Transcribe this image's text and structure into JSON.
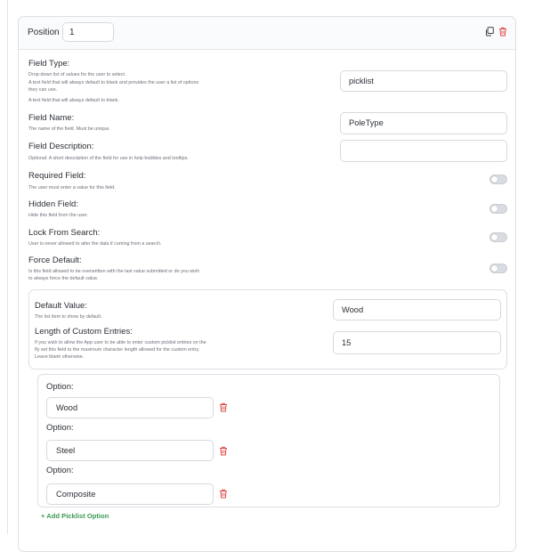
{
  "header": {
    "position_label": "Position",
    "position_value": "1",
    "copy_icon": "copy-icon",
    "delete_icon": "trash-icon"
  },
  "fields": {
    "field_type": {
      "title": "Field Type:",
      "desc1": "Drop-down list of values for the user to select.",
      "desc2": "A text field that will always default to blank and provides the user a list of options",
      "desc3": "they can use.",
      "desc4": "A text field that will always default to blank.",
      "value": "picklist"
    },
    "field_name": {
      "title": "Field Name:",
      "desc": "The name of the field. Must be unique.",
      "value": "PoleType"
    },
    "field_description": {
      "title": "Field Description:",
      "desc": "Optional: A short description of the field for use in help bubbles and tooltips.",
      "value": ""
    },
    "required": {
      "title": "Required Field:",
      "desc": "The user must enter a value for this field.",
      "on": false
    },
    "hidden": {
      "title": "Hidden Field:",
      "desc": "Hide this field from the user.",
      "on": false
    },
    "lock": {
      "title": "Lock From Search:",
      "desc": "User is never allowed to alter the data if coming from a search.",
      "on": false
    },
    "force_default": {
      "title": "Force Default:",
      "desc1": "Is this field allowed to be overwritten with the last value submitted or do you wish",
      "desc2": "to always force the default value.",
      "on": false
    }
  },
  "picklist": {
    "default_value": {
      "title": "Default Value:",
      "desc": "The list item to show by default.",
      "value": "Wood"
    },
    "custom_length": {
      "title": "Length of Custom Entries:",
      "desc1": "If you wish to allow the App user to be able to enter custom picklist entries on the",
      "desc2": "fly set this field to the maximum character length allowed for the custom entry.",
      "desc3": "Leave blank otherwise.",
      "value": "15"
    },
    "options": [
      {
        "label": "Option:",
        "value": "Wood"
      },
      {
        "label": "Option:",
        "value": "Steel"
      },
      {
        "label": "Option:",
        "value": "Composite"
      }
    ],
    "add_option": "+ Add Picklist Option"
  },
  "colors": {
    "danger": "#e04a4a",
    "success": "#3a9a55",
    "border": "#d6d9de"
  }
}
